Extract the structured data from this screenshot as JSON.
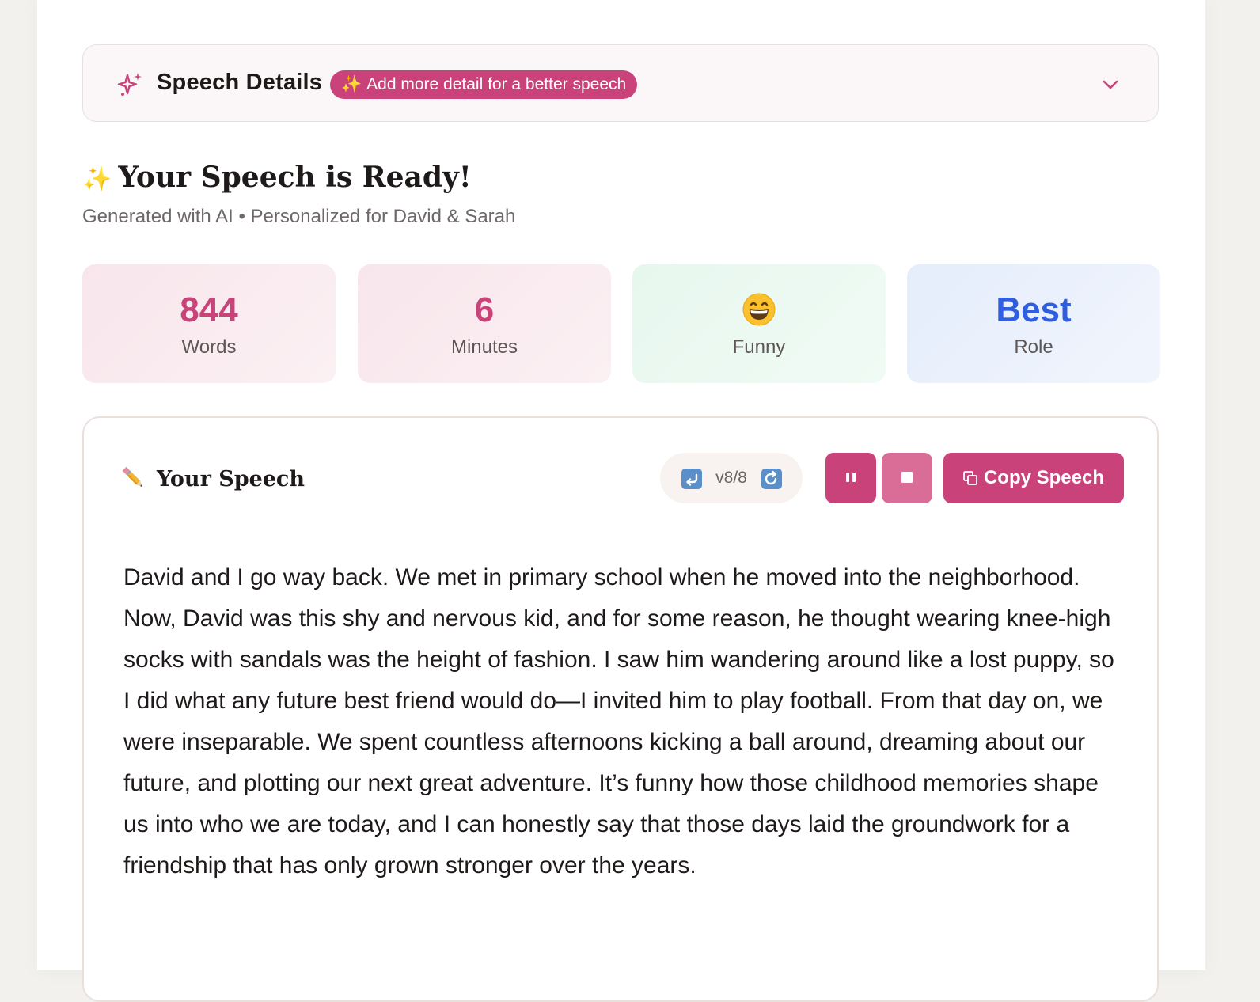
{
  "details": {
    "title": "Speech Details",
    "badge": "Add more detail for a better speech",
    "badge_icon": "sparkles-icon"
  },
  "result": {
    "emoji": "✨",
    "title": "Your Speech is Ready!",
    "subtitle": "Generated with AI • Personalized for David & Sarah"
  },
  "stats": {
    "words": {
      "value": "844",
      "label": "Words"
    },
    "minutes": {
      "value": "6",
      "label": "Minutes"
    },
    "tone": {
      "icon": "grinning-face-emoji",
      "label": "Funny"
    },
    "role": {
      "value": "Best",
      "label": "Role"
    }
  },
  "speech": {
    "heading": "Your Speech",
    "version": "v8/8",
    "copy_label": "Copy Speech",
    "text": "David and I go way back. We met in primary school when he moved into the neighborhood. Now, David was this shy and nervous kid, and for some reason, he thought wearing knee-high socks with sandals was the height of fashion. I saw him wandering around like a lost puppy, so I did what any future best friend would do—I invited him to play football. From that day on, we were inseparable. We spent countless afternoons kicking a ball around, dreaming about our future, and plotting our next great adventure. It’s funny how those childhood memories shape us into who we are today, and I can honestly say that those days laid the groundwork for a friendship that has only grown stronger over the years."
  },
  "colors": {
    "accent": "#c9437a",
    "accent_light": "#d96d97",
    "role_blue": "#2f5fe0"
  }
}
